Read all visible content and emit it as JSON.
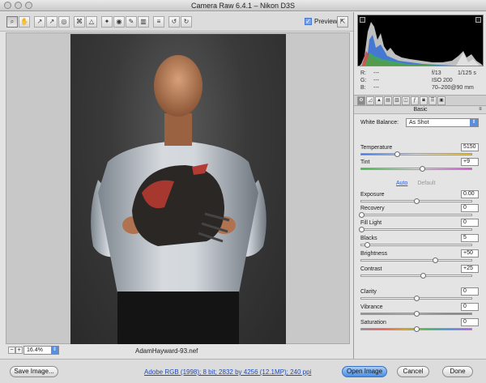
{
  "window": {
    "title": "Camera Raw 6.4.1  –  Nikon D3S"
  },
  "toolbar": {
    "tools": [
      {
        "name": "zoom-tool",
        "glyph": "⌕"
      },
      {
        "name": "hand-tool",
        "glyph": "✋"
      },
      {
        "name": "white-balance-tool",
        "glyph": "↗"
      },
      {
        "name": "color-sampler-tool",
        "glyph": "↗"
      },
      {
        "name": "targeted-adjustment-tool",
        "glyph": "◎"
      },
      {
        "name": "crop-tool",
        "glyph": "⌘"
      },
      {
        "name": "straighten-tool",
        "glyph": "△"
      },
      {
        "name": "spot-removal-tool",
        "glyph": "✦"
      },
      {
        "name": "red-eye-tool",
        "glyph": "◉"
      },
      {
        "name": "adjustment-brush-tool",
        "glyph": "✎"
      },
      {
        "name": "graduated-filter-tool",
        "glyph": "▥"
      },
      {
        "name": "preferences-tool",
        "glyph": "≡"
      },
      {
        "name": "rotate-ccw-tool",
        "glyph": "↺"
      },
      {
        "name": "rotate-cw-tool",
        "glyph": "↻"
      }
    ],
    "preview_label": "Preview"
  },
  "canvas": {
    "filename": "AdamHayward-93.nef",
    "zoom": "16.4%"
  },
  "readout": {
    "r_label": "R:",
    "r_value": "---",
    "g_label": "G:",
    "g_value": "---",
    "b_label": "B:",
    "b_value": "---",
    "aperture": "f/13",
    "shutter": "1/125 s",
    "iso": "ISO 200",
    "lens": "70–200@90 mm"
  },
  "panel": {
    "section_title": "Basic",
    "white_balance_label": "White Balance:",
    "white_balance_value": "As Shot",
    "auto_label": "Auto",
    "default_label": "Default",
    "controls": [
      {
        "id": "temperature",
        "label": "Temperature",
        "value": "5150",
        "pos": 0.32,
        "track": "temp"
      },
      {
        "id": "tint",
        "label": "Tint",
        "value": "+9",
        "pos": 0.55,
        "track": "tint"
      },
      {
        "id": "exposure",
        "label": "Exposure",
        "value": "0.00",
        "pos": 0.5,
        "track": ""
      },
      {
        "id": "recovery",
        "label": "Recovery",
        "value": "0",
        "pos": 0.0,
        "track": ""
      },
      {
        "id": "fill-light",
        "label": "Fill Light",
        "value": "0",
        "pos": 0.0,
        "track": ""
      },
      {
        "id": "blacks",
        "label": "Blacks",
        "value": "5",
        "pos": 0.05,
        "track": ""
      },
      {
        "id": "brightness",
        "label": "Brightness",
        "value": "+50",
        "pos": 0.67,
        "track": ""
      },
      {
        "id": "contrast",
        "label": "Contrast",
        "value": "+25",
        "pos": 0.56,
        "track": ""
      },
      {
        "id": "clarity",
        "label": "Clarity",
        "value": "0",
        "pos": 0.5,
        "track": ""
      },
      {
        "id": "vibrance",
        "label": "Vibrance",
        "value": "0",
        "pos": 0.5,
        "track": "vib"
      },
      {
        "id": "saturation",
        "label": "Saturation",
        "value": "0",
        "pos": 0.5,
        "track": "sat"
      }
    ]
  },
  "bottom": {
    "save_label": "Save Image...",
    "workflow_link": "Adobe RGB (1998); 8 bit; 2832 by 4256 (12.1MP); 240 ppi",
    "open_label": "Open Image",
    "cancel_label": "Cancel",
    "done_label": "Done"
  }
}
